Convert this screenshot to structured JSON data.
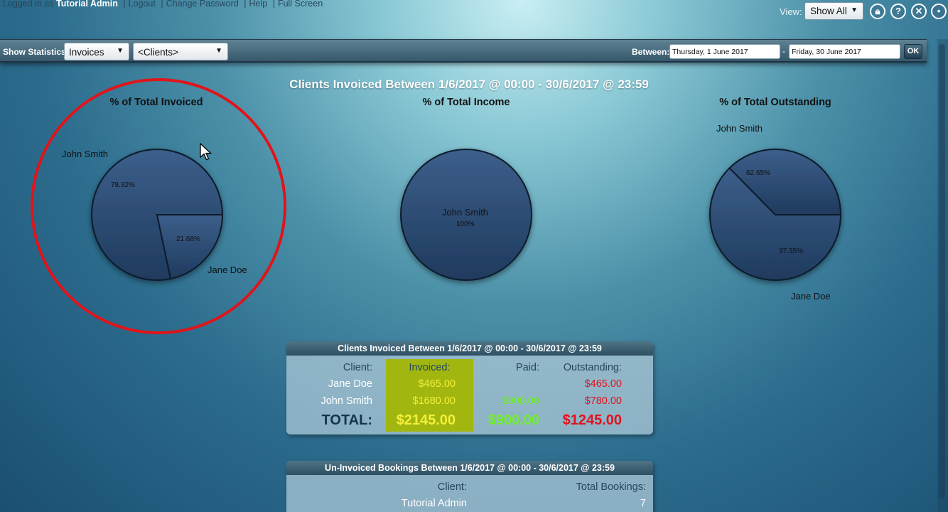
{
  "topbar": {
    "logged_in_prefix": "Logged in as",
    "user_name": "Tutorial Admin",
    "links": [
      "Logout",
      "Change Password",
      "Help",
      "Full Screen"
    ],
    "view_label": "View:",
    "view_value": "Show All",
    "icons": [
      "lock-icon",
      "help-icon",
      "close-icon",
      "settings-icon"
    ]
  },
  "statsbar": {
    "label": "Show Statistics:",
    "type_value": "Invoices",
    "client_value": "<Clients>",
    "between_label": "Between:",
    "date_from": "Thursday, 1 June 2017",
    "date_separator": "-",
    "date_to": "Friday, 30 June 2017",
    "ok_label": "OK"
  },
  "chart_title": "Clients Invoiced Between 1/6/2017 @ 00:00 - 30/6/2017 @ 23:59",
  "chart_data": [
    {
      "type": "pie",
      "title": "% of Total Invoiced",
      "labels": [
        "John Smith",
        "Jane Doe"
      ],
      "values": [
        78.32,
        21.68
      ],
      "value_labels": [
        "78.32%",
        "21.68%"
      ]
    },
    {
      "type": "pie",
      "title": "% of Total Income",
      "labels": [
        "John Smith"
      ],
      "values": [
        100
      ],
      "value_labels": [
        "100%"
      ]
    },
    {
      "type": "pie",
      "title": "% of Total Outstanding",
      "labels": [
        "John Smith",
        "Jane Doe"
      ],
      "values": [
        62.65,
        37.35
      ],
      "value_labels": [
        "62.65%",
        "37.35%"
      ]
    }
  ],
  "colors": {
    "pie_fill": "#2a4870",
    "highlight": "#e0141a",
    "invoiced_bg": "#a1b70f",
    "paid": "#6ff024",
    "outstanding": "#e2121d"
  },
  "invoice_table": {
    "title": "Clients Invoiced Between 1/6/2017 @ 00:00 - 30/6/2017 @ 23:59",
    "headers": [
      "Client:",
      "Invoiced:",
      "Paid:",
      "Outstanding:"
    ],
    "rows": [
      {
        "client": "Jane Doe",
        "invoiced": "$465.00",
        "paid": "",
        "outstanding": "$465.00"
      },
      {
        "client": "John Smith",
        "invoiced": "$1680.00",
        "paid": "$900.00",
        "outstanding": "$780.00"
      }
    ],
    "total": {
      "label": "TOTAL:",
      "invoiced": "$2145.00",
      "paid": "$900.00",
      "outstanding": "$1245.00"
    }
  },
  "uninvoiced_table": {
    "title": "Un-Invoiced Bookings Between 1/6/2017 @ 00:00 - 30/6/2017 @ 23:59",
    "headers": [
      "Client:",
      "Total Bookings:"
    ],
    "rows": [
      {
        "client": "Tutorial Admin",
        "bookings": "7"
      }
    ]
  }
}
